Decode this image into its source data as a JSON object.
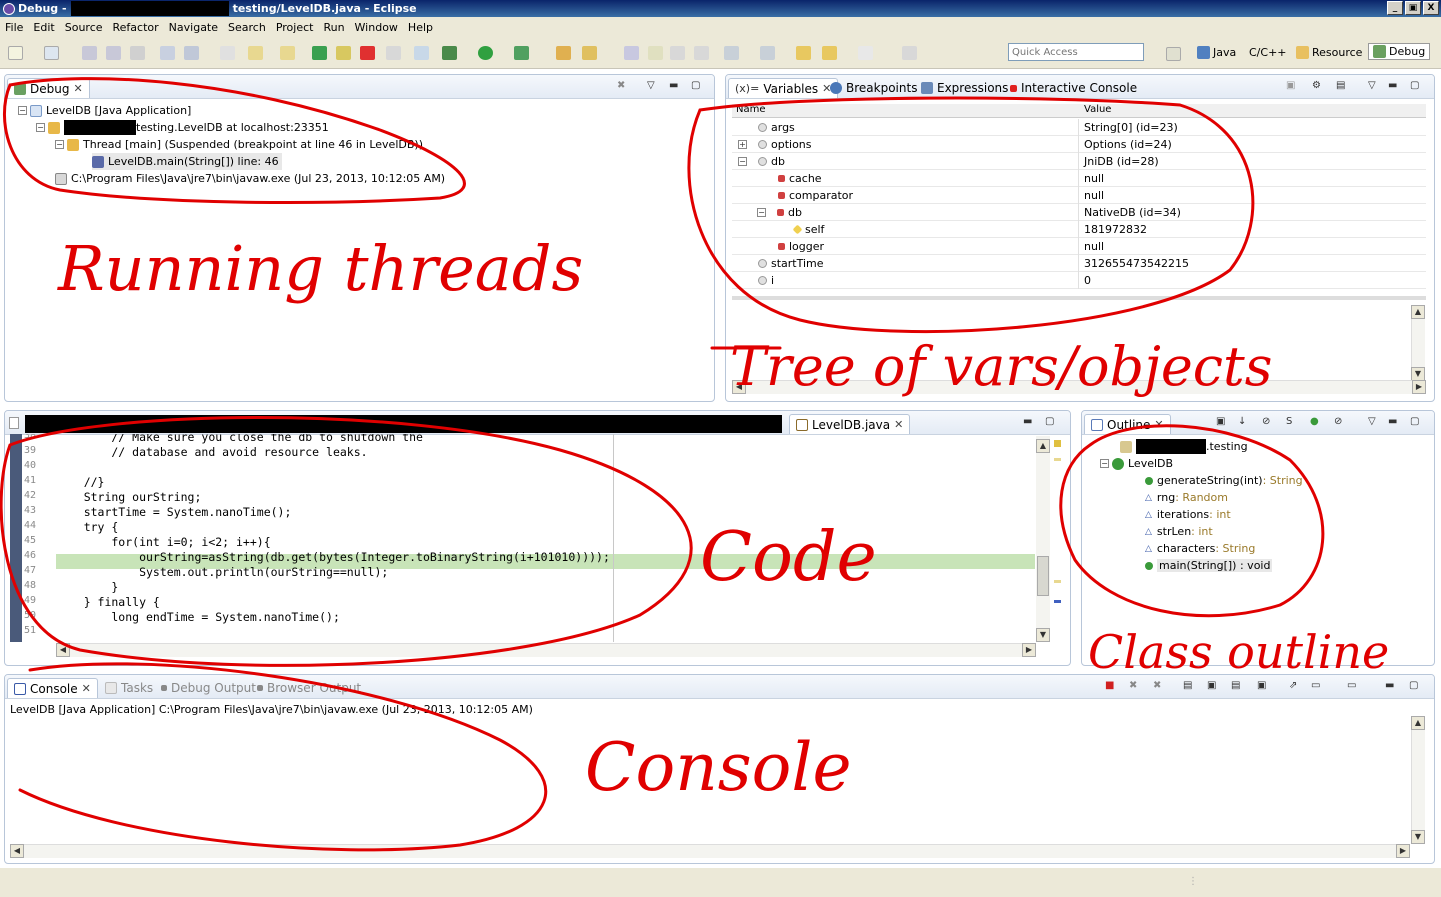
{
  "window": {
    "title_prefix": "Debug -",
    "title_suffix": "testing/LevelDB.java - Eclipse",
    "controls": [
      "_",
      "▣",
      "X"
    ]
  },
  "menu": [
    "File",
    "Edit",
    "Source",
    "Refactor",
    "Navigate",
    "Search",
    "Project",
    "Run",
    "Window",
    "Help"
  ],
  "toolbar": {
    "quick_access_placeholder": "Quick Access",
    "perspectives": [
      {
        "label": "Java",
        "icon": "java-perspective-icon"
      },
      {
        "label": "C/C++",
        "icon": "cpp-perspective-icon"
      },
      {
        "label": "Resource",
        "icon": "resource-perspective-icon"
      },
      {
        "label": "Debug",
        "icon": "debug-perspective-icon",
        "active": true
      }
    ]
  },
  "debug_view": {
    "tab": "Debug",
    "launch": "LevelDB [Java Application]",
    "vm": "testing.LevelDB at localhost:23351",
    "thread": "Thread [main] (Suspended (breakpoint at line 46 in LevelDB))",
    "frame": "LevelDB.main(String[]) line: 46",
    "process": "C:\\Program Files\\Java\\jre7\\bin\\javaw.exe (Jul 23, 2013, 10:12:05 AM)"
  },
  "variables_view": {
    "tabs": [
      "Variables",
      "Breakpoints",
      "Expressions",
      "Interactive Console"
    ],
    "columns": [
      "Name",
      "Value"
    ],
    "rows": [
      {
        "name": "args",
        "value": "String[0]  (id=23)"
      },
      {
        "name": "options",
        "value": "Options  (id=24)"
      },
      {
        "name": "db",
        "value": "JniDB  (id=28)"
      },
      {
        "name": "cache",
        "value": "null"
      },
      {
        "name": "comparator",
        "value": "null"
      },
      {
        "name": "db",
        "value": "NativeDB  (id=34)"
      },
      {
        "name": "self",
        "value": "181972832"
      },
      {
        "name": "logger",
        "value": "null"
      },
      {
        "name": "startTime",
        "value": "312655473542215"
      },
      {
        "name": "i",
        "value": "0"
      }
    ]
  },
  "editor": {
    "tab": "LevelDB.java",
    "lines": [
      {
        "no": "38",
        "text": "        // Make sure you close the db to shutdown the"
      },
      {
        "no": "39",
        "text": "        // database and avoid resource leaks."
      },
      {
        "no": "40",
        "text": ""
      },
      {
        "no": "41",
        "text": "    //}"
      },
      {
        "no": "42",
        "text": "    String ourString;"
      },
      {
        "no": "43",
        "text": "    startTime = System.nanoTime();"
      },
      {
        "no": "44",
        "text": "    try {"
      },
      {
        "no": "45",
        "text": "        for(int i=0; i<2; i++){"
      },
      {
        "no": "46",
        "text": "            ourString=asString(db.get(bytes(Integer.toBinaryString(i+101010))));"
      },
      {
        "no": "47",
        "text": "            System.out.println(ourString==null);"
      },
      {
        "no": "48",
        "text": "        }"
      },
      {
        "no": "49",
        "text": "    } finally {"
      },
      {
        "no": "50",
        "text": "        long endTime = System.nanoTime();"
      },
      {
        "no": "51",
        "text": ""
      }
    ]
  },
  "outline_view": {
    "tab": "Outline",
    "package": ".testing",
    "class": "LevelDB",
    "members": [
      {
        "name": "generateString(int)",
        "type": " : String"
      },
      {
        "name": "rng",
        "type": " : Random"
      },
      {
        "name": "iterations",
        "type": " : int"
      },
      {
        "name": "strLen",
        "type": " : int"
      },
      {
        "name": "characters",
        "type": " : String"
      },
      {
        "name": "main(String[])",
        "type": " : void"
      }
    ]
  },
  "console_view": {
    "tabs": [
      "Console",
      "Tasks",
      "Debug Output",
      "Browser Output"
    ],
    "process": "LevelDB [Java Application] C:\\Program Files\\Java\\jre7\\bin\\javaw.exe (Jul 23, 2013, 10:12:05 AM)"
  },
  "annotations": {
    "threads": "Running threads",
    "vars": "Tree of vars/objects",
    "code": "Code",
    "outline": "Class outline",
    "console": "Console",
    "color": "#e00000"
  }
}
